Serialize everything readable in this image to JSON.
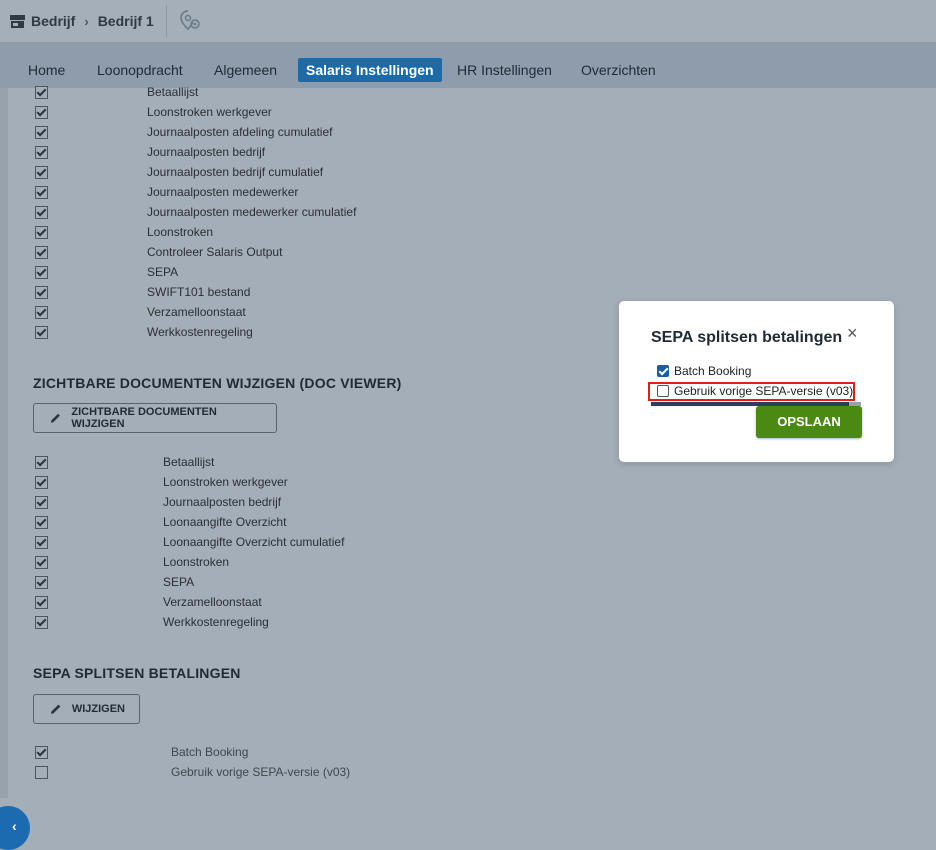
{
  "header": {
    "breadcrumb": [
      "Bedrijf",
      "Bedrijf 1"
    ],
    "separator": "›"
  },
  "tabs": [
    {
      "label": "Home",
      "active": false
    },
    {
      "label": "Loonopdracht",
      "active": false
    },
    {
      "label": "Algemeen",
      "active": false
    },
    {
      "label": "Salaris Instellingen",
      "active": true
    },
    {
      "label": "HR Instellingen",
      "active": false
    },
    {
      "label": "Overzichten",
      "active": false
    }
  ],
  "list1": [
    {
      "label": "Betaallijst",
      "checked": true
    },
    {
      "label": "Loonstroken werkgever",
      "checked": true
    },
    {
      "label": "Journaalposten afdeling cumulatief",
      "checked": true
    },
    {
      "label": "Journaalposten bedrijf",
      "checked": true
    },
    {
      "label": "Journaalposten bedrijf cumulatief",
      "checked": true
    },
    {
      "label": "Journaalposten medewerker",
      "checked": true
    },
    {
      "label": "Journaalposten medewerker cumulatief",
      "checked": true
    },
    {
      "label": "Loonstroken",
      "checked": true
    },
    {
      "label": "Controleer Salaris Output",
      "checked": true
    },
    {
      "label": "SEPA",
      "checked": true
    },
    {
      "label": "SWIFT101 bestand",
      "checked": true
    },
    {
      "label": "Verzamelloonstaat",
      "checked": true
    },
    {
      "label": "Werkkostenregeling",
      "checked": true
    }
  ],
  "section_docviewer": {
    "title": "ZICHTBARE DOCUMENTEN WIJZIGEN (DOC VIEWER)",
    "button": "ZICHTBARE DOCUMENTEN WIJZIGEN"
  },
  "list2": [
    {
      "label": "Betaallijst",
      "checked": true
    },
    {
      "label": "Loonstroken werkgever",
      "checked": true
    },
    {
      "label": "Journaalposten bedrijf",
      "checked": true
    },
    {
      "label": "Loonaangifte Overzicht",
      "checked": true
    },
    {
      "label": "Loonaangifte Overzicht cumulatief",
      "checked": true
    },
    {
      "label": "Loonstroken",
      "checked": true
    },
    {
      "label": "SEPA",
      "checked": true
    },
    {
      "label": "Verzamelloonstaat",
      "checked": true
    },
    {
      "label": "Werkkostenregeling",
      "checked": true
    }
  ],
  "section_sepa": {
    "title": "SEPA SPLITSEN BETALINGEN",
    "button": "WIJZIGEN"
  },
  "list3": [
    {
      "label": "Batch Booking",
      "checked": true
    },
    {
      "label": "Gebruik vorige SEPA-versie (v03)",
      "checked": false
    }
  ],
  "modal": {
    "title": "SEPA splitsen betalingen",
    "close": "×",
    "options": [
      {
        "label": "Batch Booking",
        "checked": true
      },
      {
        "label": "Gebruik vorige SEPA-versie (v03)",
        "checked": false
      }
    ],
    "save": "OPSLAAN"
  },
  "side_toggle": "‹",
  "colors": {
    "accent": "#1d6aa8",
    "save": "#4b8a12",
    "highlight": "#e41c1c"
  }
}
